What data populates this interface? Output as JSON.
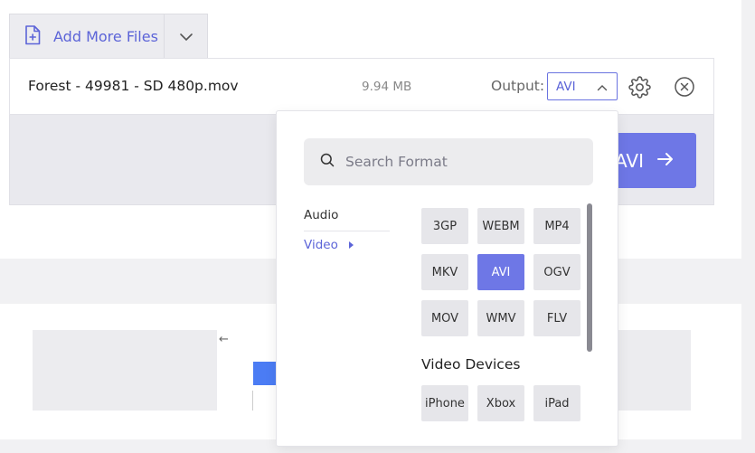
{
  "toolbar": {
    "add_files_label": "Add More Files"
  },
  "file": {
    "name": "Forest - 49981 - SD 480p.mov",
    "size": "9.94 MB",
    "output_label": "Output:",
    "output_value": "AVI"
  },
  "convert": {
    "label": "AVI"
  },
  "popup": {
    "search_placeholder": "Search Format",
    "categories": [
      {
        "label": "Audio"
      },
      {
        "label": "Video"
      }
    ],
    "formats": [
      {
        "label": "3GP"
      },
      {
        "label": "WEBM"
      },
      {
        "label": "MP4"
      },
      {
        "label": "MKV"
      },
      {
        "label": "AVI"
      },
      {
        "label": "OGV"
      },
      {
        "label": "MOV"
      },
      {
        "label": "WMV"
      },
      {
        "label": "FLV"
      }
    ],
    "devices_heading": "Video Devices",
    "devices": [
      {
        "label": "iPhone"
      },
      {
        "label": "Xbox"
      },
      {
        "label": "iPad"
      }
    ]
  },
  "preview": {
    "back_arrow": "←"
  },
  "colors": {
    "accent": "#6e77e6",
    "link": "#5c64d8"
  }
}
